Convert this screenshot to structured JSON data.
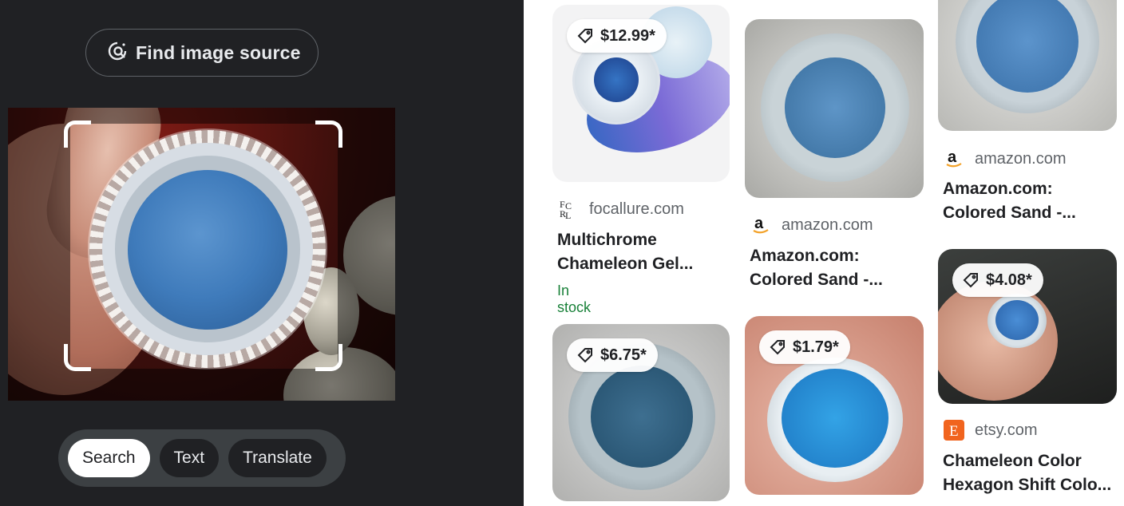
{
  "left": {
    "find_image_source": "Find image source",
    "modes": [
      "Search",
      "Text",
      "Translate"
    ],
    "active_mode": "Search"
  },
  "results": [
    {
      "price": "$12.99*",
      "source": "focallure.com",
      "title_line1": "Multichrome",
      "title_line2": "Chameleon Gel...",
      "stock": "In stock"
    },
    {
      "price": "",
      "source": "amazon.com",
      "title_line1": "Amazon.com:",
      "title_line2": "Colored Sand -..."
    },
    {
      "price": "",
      "source": "amazon.com",
      "title_line1": "Amazon.com:",
      "title_line2": "Colored Sand -..."
    },
    {
      "price": "$6.75*"
    },
    {
      "price": "$1.79*"
    },
    {
      "price": "$4.08*",
      "source": "etsy.com",
      "title_line1": "Chameleon Color",
      "title_line2": "Hexagon Shift Colo..."
    }
  ],
  "colors": {
    "dark_bg": "#202124",
    "in_stock": "#188038",
    "etsy": "#f1641e"
  }
}
